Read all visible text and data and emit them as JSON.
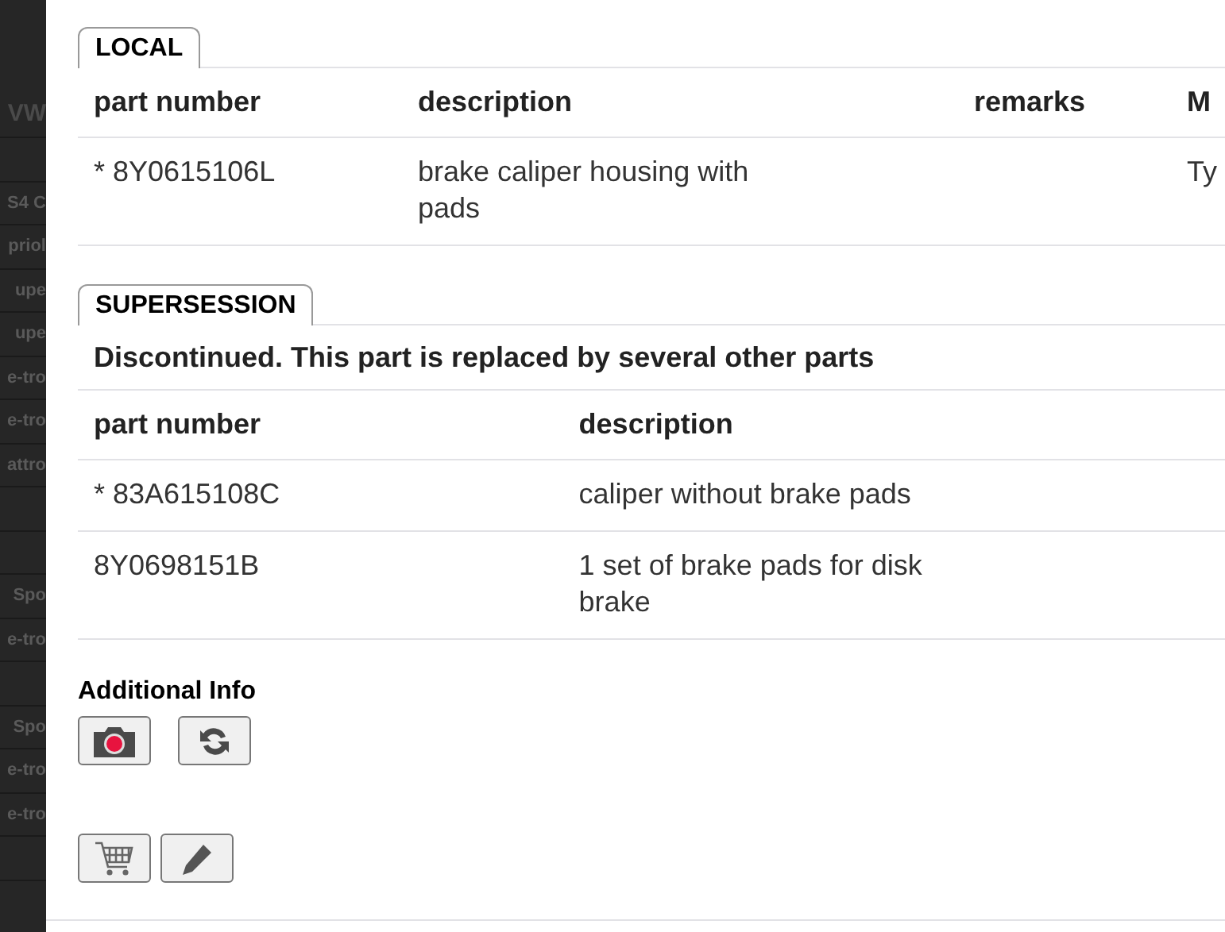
{
  "background_list": [
    {
      "text": "VW",
      "kind": "heading"
    },
    {
      "kind": "row"
    },
    {
      "text": "S4 C",
      "kind": "row"
    },
    {
      "text": "priol",
      "kind": "row"
    },
    {
      "text": "upe",
      "kind": "row"
    },
    {
      "text": "upe",
      "kind": "row"
    },
    {
      "text": "e-tro",
      "kind": "row"
    },
    {
      "text": "e-tro",
      "kind": "row"
    },
    {
      "text": "attro",
      "kind": "row"
    },
    {
      "kind": "row"
    },
    {
      "kind": "row"
    },
    {
      "text": "Spo",
      "kind": "row"
    },
    {
      "text": "e-tro",
      "kind": "row"
    },
    {
      "kind": "row"
    },
    {
      "text": "Spo",
      "kind": "row"
    },
    {
      "text": "e-tro",
      "kind": "row"
    },
    {
      "text": "e-tro",
      "kind": "row"
    },
    {
      "kind": "row"
    }
  ],
  "local": {
    "tab": "LOCAL",
    "columns": [
      "part number",
      "description",
      "remarks",
      "M"
    ],
    "rows": [
      [
        "* 8Y0615106L",
        "brake caliper housing with pads",
        "",
        "Ty"
      ]
    ]
  },
  "supersession": {
    "tab": "SUPERSESSION",
    "message": "Discontinued. This part is replaced by several other parts",
    "columns": [
      "part number",
      "description"
    ],
    "rows": [
      [
        "* 83A615108C",
        "caliper without brake pads"
      ],
      [
        "8Y0698151B",
        "1 set of brake pads for disk brake"
      ]
    ]
  },
  "additional_info": {
    "title": "Additional Info",
    "buttons": [
      {
        "kind": "camera"
      },
      {
        "kind": "refresh"
      }
    ]
  },
  "actions": [
    {
      "kind": "cart"
    },
    {
      "kind": "edit"
    }
  ]
}
